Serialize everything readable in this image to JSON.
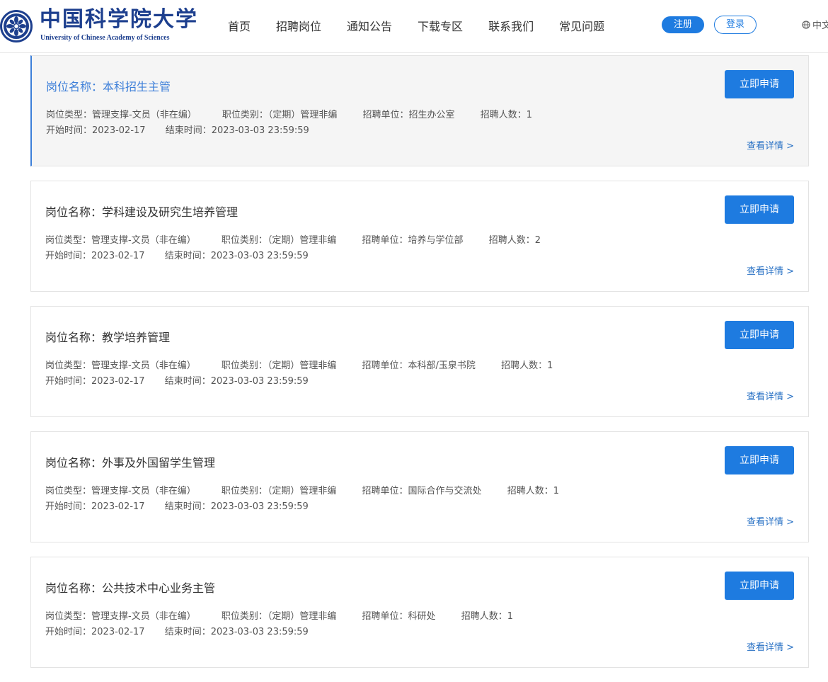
{
  "header": {
    "logo_cn": "中国科学院大学",
    "logo_en": "University of  Chinese Academy of Sciences",
    "nav": [
      "首页",
      "招聘岗位",
      "通知公告",
      "下载专区",
      "联系我们",
      "常见问题"
    ],
    "register": "注册",
    "login": "登录",
    "lang": "中文",
    "accent": "#1e7be0"
  },
  "labels": {
    "title_prefix": "岗位名称：",
    "type": "岗位类型：",
    "category": "职位类别：",
    "unit": "招聘单位：",
    "count": "招聘人数：",
    "start": "开始时间：",
    "end": "结束时间：",
    "apply": "立即申请",
    "detail": "查看详情 >"
  },
  "jobs": [
    {
      "title": "本科招生主管",
      "type": "管理支撑-文员（非在编）",
      "category": "（定期）管理非编",
      "unit": "招生办公室",
      "count": "1",
      "start": "2023-02-17",
      "end": "2023-03-03 23:59:59"
    },
    {
      "title": "学科建设及研究生培养管理",
      "type": "管理支撑-文员（非在编）",
      "category": "（定期）管理非编",
      "unit": "培养与学位部",
      "count": "2",
      "start": "2023-02-17",
      "end": "2023-03-03 23:59:59"
    },
    {
      "title": "教学培养管理",
      "type": "管理支撑-文员（非在编）",
      "category": "（定期）管理非编",
      "unit": "本科部/玉泉书院",
      "count": "1",
      "start": "2023-02-17",
      "end": "2023-03-03 23:59:59"
    },
    {
      "title": "外事及外国留学生管理",
      "type": "管理支撑-文员（非在编）",
      "category": "（定期）管理非编",
      "unit": "国际合作与交流处",
      "count": "1",
      "start": "2023-02-17",
      "end": "2023-03-03 23:59:59"
    },
    {
      "title": "公共技术中心业务主管",
      "type": "管理支撑-文员（非在编）",
      "category": "（定期）管理非编",
      "unit": "科研处",
      "count": "1",
      "start": "2023-02-17",
      "end": "2023-03-03 23:59:59"
    }
  ]
}
